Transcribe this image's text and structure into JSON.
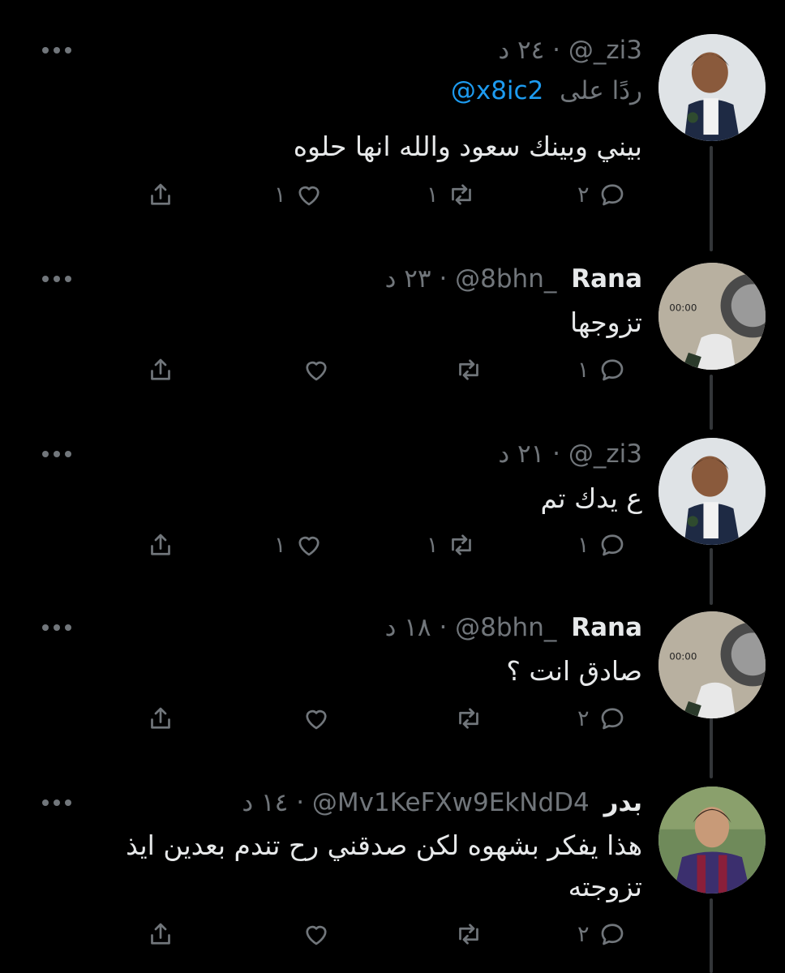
{
  "tweets": [
    {
      "name": "",
      "handle": "@_zi3",
      "time": "٢٤ د",
      "reply_prefix": "ردًا على",
      "reply_mention": "@x8ic2",
      "text": "بيني وبينك سعود والله انها حلوه",
      "replies": "٢",
      "retweets": "١",
      "likes": "١",
      "avatar": "boy-avatar"
    },
    {
      "name": "Rana",
      "handle": "@8bhn_",
      "time": "٢٣ د",
      "text": "تزوجها",
      "replies": "١",
      "retweets": "",
      "likes": "",
      "avatar": "car-wheel-avatar",
      "avatar_timer": "00:00"
    },
    {
      "name": "",
      "handle": "@_zi3",
      "time": "٢١ د",
      "text": "ع يدك تم",
      "replies": "١",
      "retweets": "١",
      "likes": "١",
      "avatar": "boy-avatar"
    },
    {
      "name": "Rana",
      "handle": "@8bhn_",
      "time": "١٨ د",
      "text": "صادق انت ؟",
      "replies": "٢",
      "retweets": "",
      "likes": "",
      "avatar": "car-wheel-avatar",
      "avatar_timer": "00:00"
    },
    {
      "name": "بدر",
      "handle": "@Mv1KeFXw9EkNdD4",
      "time": "١٤ د",
      "text": "هذا يفكر بشهوه لكن صدقني رح تندم بعدين ايذ تزوجته",
      "replies": "٢",
      "retweets": "",
      "likes": "",
      "avatar": "football-player-avatar"
    }
  ],
  "separator": "·",
  "colors": {
    "background": "#000000",
    "text": "#e7e9ea",
    "muted": "#71767b",
    "mention": "#1d9bf0",
    "thread_line": "#333639"
  }
}
